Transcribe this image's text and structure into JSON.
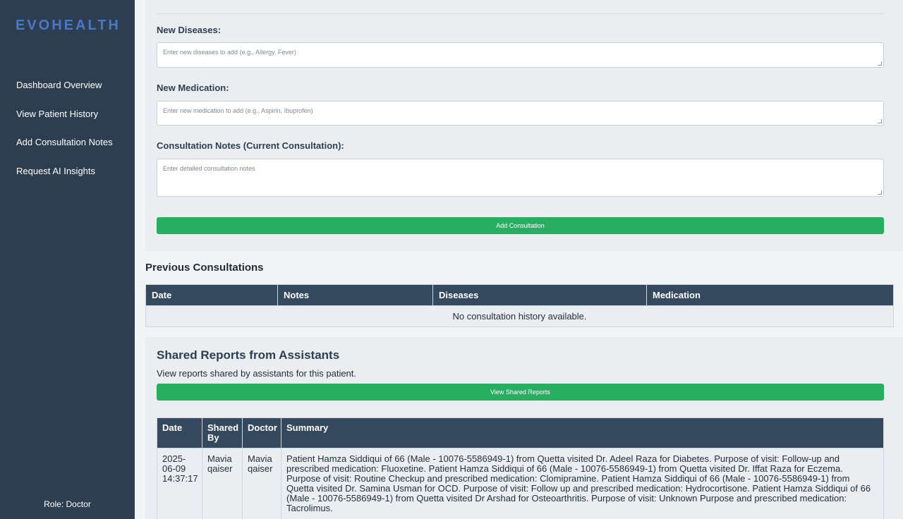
{
  "brand": {
    "logo_text": "EVOHEALTH",
    "logo_color": "#4a78c8"
  },
  "sidebar": {
    "items": [
      {
        "label": "Dashboard Overview"
      },
      {
        "label": "View Patient History"
      },
      {
        "label": "Add Consultation Notes"
      },
      {
        "label": "Request AI Insights"
      }
    ],
    "role": "Role: Doctor"
  },
  "form": {
    "diseases_label": "New Diseases:",
    "diseases_placeholder": "Enter new diseases to add (e.g., Allergy, Fever)",
    "medication_label": "New Medication:",
    "medication_placeholder": "Enter new medication to add (e.g., Aspirin, Ibuprofen)",
    "notes_label": "Consultation Notes (Current Consultation):",
    "notes_placeholder": "Enter detailed consultation notes",
    "submit_label": "Add Consultation"
  },
  "previous": {
    "title": "Previous Consultations",
    "columns": [
      "Date",
      "Notes",
      "Diseases",
      "Medication"
    ],
    "empty_message": "No consultation history available."
  },
  "shared": {
    "title": "Shared Reports from Assistants",
    "description": "View reports shared by assistants for this patient.",
    "button_label": "View Shared Reports",
    "columns": [
      "Date",
      "Shared By",
      "Doctor",
      "Summary"
    ],
    "rows": [
      {
        "date": "2025-06-09 14:37:17",
        "shared_by": "Mavia qaiser",
        "doctor": "Mavia qaiser",
        "summary": "Patient Hamza Siddiqui of 66 (Male - 10076-5586949-1) from Quetta visited Dr. Adeel Raza for Diabetes. Purpose of visit: Follow-up and prescribed medication: Fluoxetine. Patient Hamza Siddiqui of 66 (Male - 10076-5586949-1) from Quetta visited Dr. Iffat Raza for Eczema. Purpose of visit: Routine Checkup and prescribed medication: Clomipramine. Patient Hamza Siddiqui of 66 (Male - 10076-5586949-1) from Quetta visited Dr. Samina Usman for OCD. Purpose of visit: Follow up and prescribed medication: Hydrocortisone. Patient Hamza Siddiqui of 66 (Male - 10076-5586949-1) from Quetta visited Dr Arshad for Osteoarthritis. Purpose of visit: Unknown Purpose and prescribed medication: Tacrolimus."
      }
    ]
  },
  "colors": {
    "sidebar": "#2c3e50",
    "header": "#34495e",
    "accent": "#27ae60"
  }
}
